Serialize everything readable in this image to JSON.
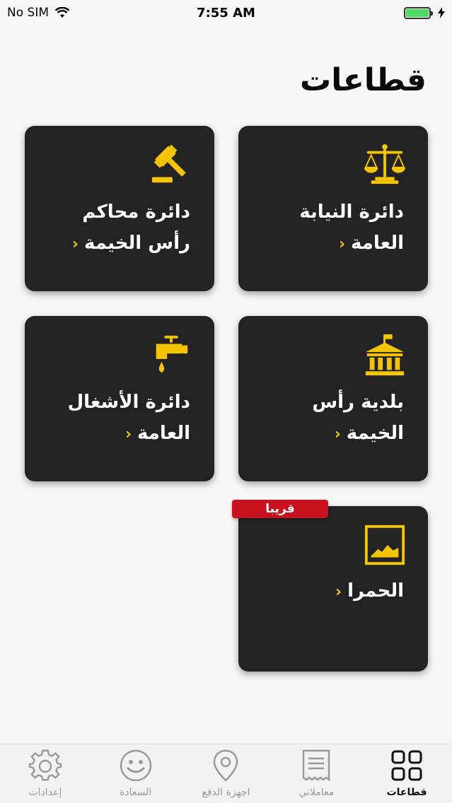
{
  "status_bar": {
    "carrier": "No SIM",
    "time": "7:55 AM"
  },
  "page": {
    "title": "قطاعات"
  },
  "cards": [
    {
      "line1": "دائرة النيابة",
      "line2": "العامة",
      "icon": "scales-icon"
    },
    {
      "line1": "دائرة محاكم",
      "line2": "رأس الخيمة",
      "icon": "gavel-icon"
    },
    {
      "line1": "بلدية رأس",
      "line2": "الخيمة",
      "icon": "building-icon"
    },
    {
      "line1": "دائرة الأشغال",
      "line2": "العامة",
      "icon": "faucet-icon"
    },
    {
      "line1": "الحمرا",
      "line2": "",
      "icon": "image-icon"
    }
  ],
  "badge": {
    "soon": "قريبا"
  },
  "chevron": "‹",
  "tabs": [
    {
      "label": "إعدادات",
      "icon": "gear-icon",
      "active": false
    },
    {
      "label": "السعادة",
      "icon": "smiley-icon",
      "active": false
    },
    {
      "label": "اجهزة الدفع",
      "icon": "location-pin-icon",
      "active": false
    },
    {
      "label": "معاملاتي",
      "icon": "receipt-icon",
      "active": false
    },
    {
      "label": "قطاعات",
      "icon": "grid-icon",
      "active": true
    }
  ],
  "colors": {
    "accent": "#f5c400",
    "card_bg": "#232323",
    "badge_red": "#c8101e"
  }
}
